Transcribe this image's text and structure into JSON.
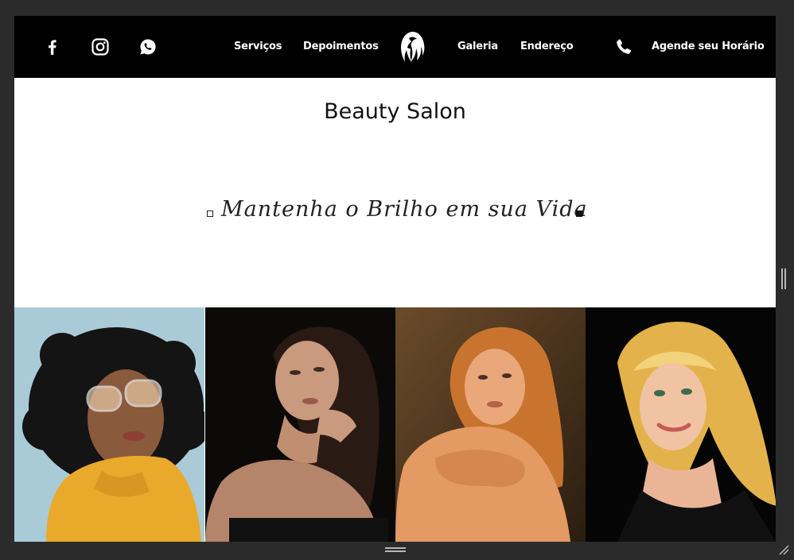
{
  "nav": {
    "social": [
      "facebook-icon",
      "instagram-icon",
      "whatsapp-icon"
    ],
    "links": [
      "Serviços",
      "Depoimentos",
      "Galeria",
      "Endereço"
    ],
    "cta": "Agende seu Horário"
  },
  "hero": {
    "title": "Beauty Salon",
    "tagline": "Mantenha o Brilho em sua Vida"
  },
  "gallery": {
    "photos": [
      "curly-hair-woman-photo",
      "dark-hair-woman-photo",
      "sunset-hair-woman-photo",
      "blonde-woman-photo"
    ]
  },
  "colors": {
    "nav_bg": "#000000",
    "page_bg": "#ffffff",
    "frame": "#2b2b2b"
  }
}
